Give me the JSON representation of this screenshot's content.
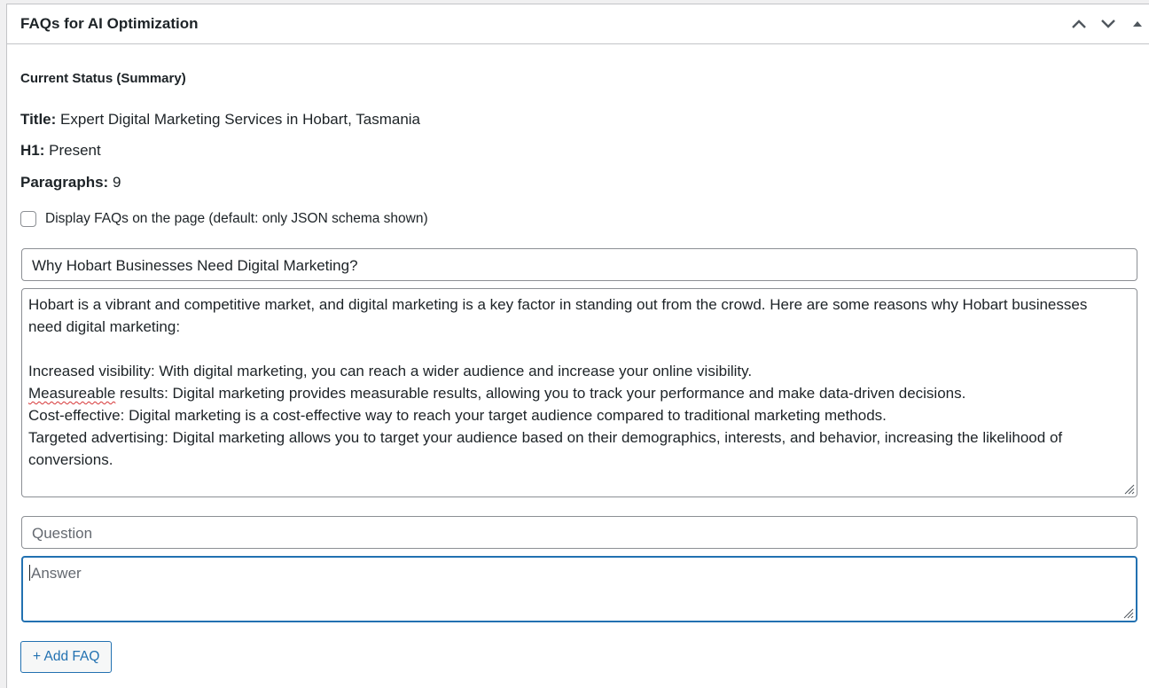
{
  "postbox": {
    "title": "FAQs for AI Optimization",
    "controls": {
      "move_up_icon": "chevron-up-icon",
      "move_down_icon": "chevron-down-icon",
      "toggle_icon": "triangle-up-icon"
    }
  },
  "status": {
    "heading": "Current Status (Summary)",
    "title_label": "Title:",
    "title_value": "Expert Digital Marketing Services in Hobart, Tasmania",
    "h1_label": "H1:",
    "h1_value": "Present",
    "paragraphs_label": "Paragraphs:",
    "paragraphs_value": "9"
  },
  "display_faqs": {
    "label": "Display FAQs on the page (default: only JSON schema shown)",
    "checked": false
  },
  "faqs": [
    {
      "question": "Why Hobart Businesses Need Digital Marketing?",
      "answer_lines": [
        "Hobart is a vibrant and competitive market, and digital marketing is a key factor in standing out from the crowd. Here are some reasons why Hobart businesses",
        "need digital marketing:",
        "",
        "Increased visibility: With digital marketing, you can reach a wider audience and increase your online visibility.",
        "Measureable",
        " results: Digital marketing provides measurable results, allowing you to track your performance and make data-driven decisions.",
        "Cost-effective: Digital marketing is a cost-effective way to reach your target audience compared to traditional marketing methods.",
        "Targeted advertising: Digital marketing allows you to target your audience based on their demographics, interests, and behavior, increasing the likelihood of",
        "conversions."
      ]
    }
  ],
  "new_faq": {
    "question_placeholder": "Question",
    "answer_placeholder": "Answer"
  },
  "add_button": "+ Add FAQ"
}
